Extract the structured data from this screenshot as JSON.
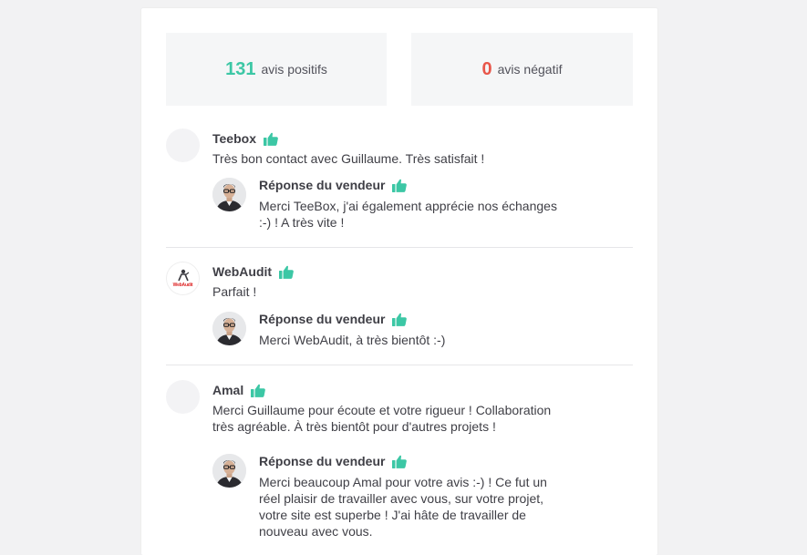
{
  "stats": {
    "positive_count": "131",
    "positive_label": "avis positifs",
    "negative_count": "0",
    "negative_label": "avis négatif"
  },
  "colors": {
    "positive": "#3cc7a5",
    "negative": "#e8564a",
    "thumb": "#3cc7a5"
  },
  "reviews": [
    {
      "author": "Teebox",
      "text": "Très bon contact avec Guillaume. Très satisfait !",
      "reply_title": "Réponse du vendeur",
      "reply_text": "Merci TeeBox, j'ai également apprécie nos échanges :-) ! A très vite !"
    },
    {
      "author": "WebAudit",
      "logo_text": "WebAudit",
      "text": "Parfait !",
      "reply_title": "Réponse du vendeur",
      "reply_text": "Merci WebAudit, à très bientôt :-)"
    },
    {
      "author": "Amal",
      "text": "Merci Guillaume pour écoute et votre rigueur ! Collaboration très agréable. À très bientôt pour d'autres projets !",
      "reply_title": "Réponse du vendeur",
      "reply_text": "Merci beaucoup Amal pour votre avis :-) ! Ce fut un réel plaisir de travailler avec vous, sur votre projet, votre site est superbe ! J'ai hâte de travailler de nouveau avec vous."
    }
  ],
  "icons": {
    "thumb": "thumbs-up-icon"
  }
}
